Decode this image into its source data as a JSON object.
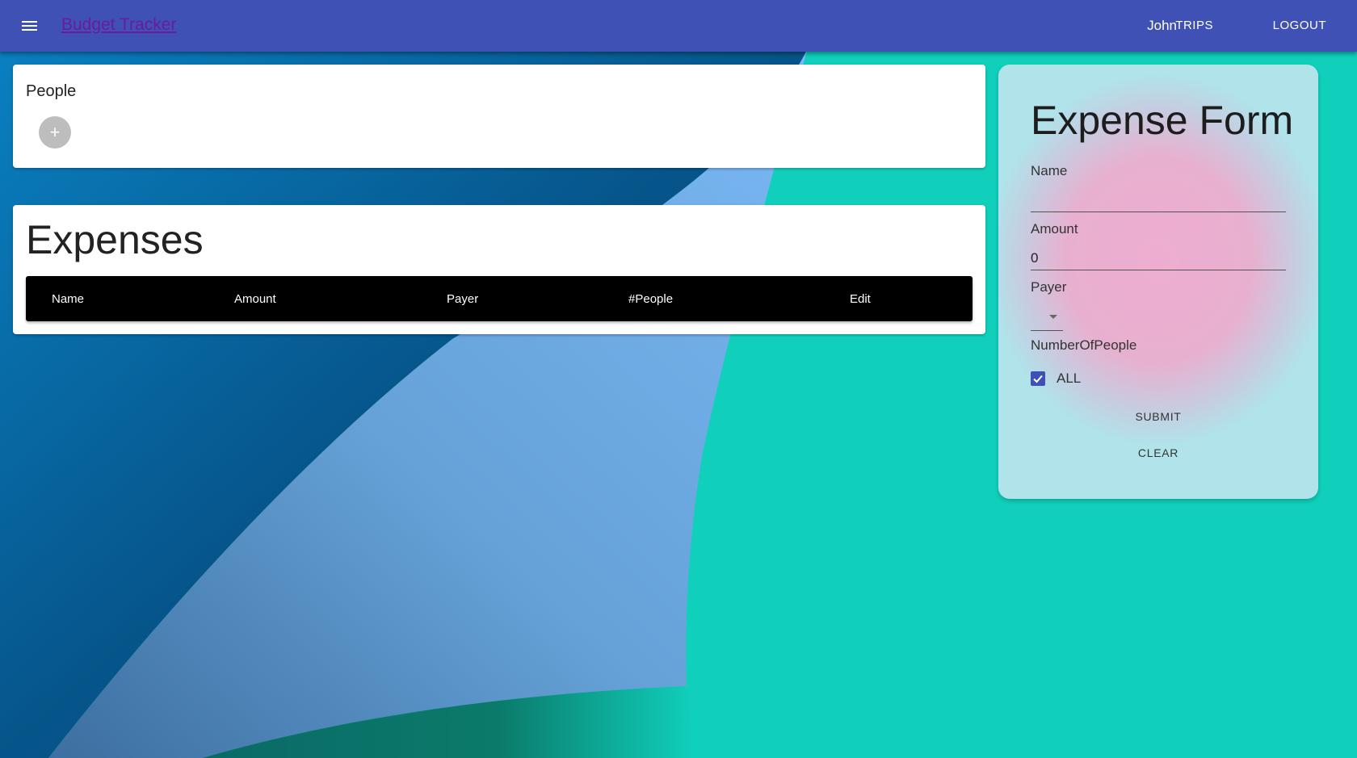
{
  "appbar": {
    "title": "Budget Tracker",
    "user": "John",
    "trips_label": "TRIPS",
    "logout_label": "LOGOUT",
    "color": "#3f51b5"
  },
  "people": {
    "title": "People",
    "add_label": "+"
  },
  "expenses": {
    "title": "Expenses",
    "columns": [
      "Name",
      "Amount",
      "Payer",
      "#People",
      "Edit"
    ]
  },
  "expense_form": {
    "title": "Expense Form",
    "name_label": "Name",
    "name_value": "",
    "amount_label": "Amount",
    "amount_value": "0",
    "payer_label": "Payer",
    "number_label": "NumberOfPeople",
    "all_label": "ALL",
    "all_checked": true,
    "submit_label": "SUBMIT",
    "clear_label": "CLEAR"
  }
}
